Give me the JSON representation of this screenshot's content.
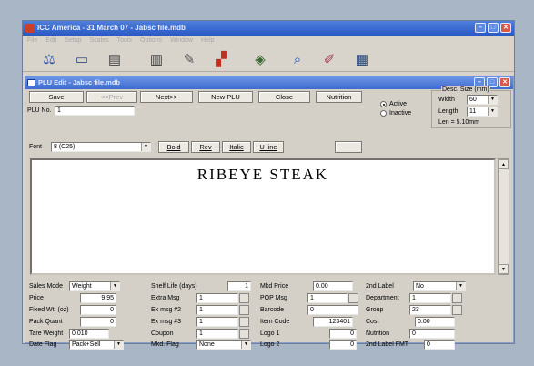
{
  "window": {
    "title": "ICC America - 31 March 07 - Jabsc file.mdb"
  },
  "menu": [
    "File",
    "Edit",
    "Setup",
    "Scales",
    "Tools",
    "Options",
    "Window",
    "Help"
  ],
  "toolbar": [
    {
      "name": "scale-icon",
      "glyph": "⚖"
    },
    {
      "name": "monitor-icon",
      "glyph": "▭"
    },
    {
      "name": "database-icon",
      "glyph": "▤"
    },
    {
      "name": "barcode-icon",
      "glyph": "▥"
    },
    {
      "name": "text-edit-icon",
      "glyph": "✎"
    },
    {
      "name": "chart-icon",
      "glyph": "▞"
    },
    {
      "name": "graphic-icon",
      "glyph": "◈"
    },
    {
      "name": "search-icon",
      "glyph": "⌕"
    },
    {
      "name": "pencil-icon",
      "glyph": "✐"
    },
    {
      "name": "screen-icon",
      "glyph": "▦"
    }
  ],
  "sub": {
    "title": "PLU Edit - Jabsc file.mdb"
  },
  "buttons": {
    "save": "Save",
    "prev": "<<Prev",
    "next": "Next>>",
    "newplu": "New PLU",
    "close": "Close",
    "nutrition": "Nutrition"
  },
  "plu": {
    "label": "PLU No.",
    "value": "1"
  },
  "status": {
    "active": "Active",
    "inactive": "Inactive"
  },
  "desc": {
    "title": "Desc. Size (mm)",
    "width_label": "Width",
    "width_value": "60",
    "length_label": "Length",
    "length_value": "11",
    "len_text": "Len = 5.10mm"
  },
  "font": {
    "label": "Font",
    "value": "8 (C25)"
  },
  "format": {
    "bold": "Bold",
    "rev": "Rev",
    "italic": "Italic",
    "uline": "U line"
  },
  "editor": {
    "text": "RIBEYE STEAK"
  },
  "fields": {
    "sales_mode": {
      "label": "Sales Mode",
      "value": "Weight"
    },
    "price": {
      "label": "Price",
      "value": "9.95"
    },
    "fixed_wt": {
      "label": "Fixed Wt. (oz)",
      "value": "0"
    },
    "pack_quant": {
      "label": "Pack Quant",
      "value": "0"
    },
    "tare_weight": {
      "label": "Tare Weight",
      "value": "0.010"
    },
    "date_flag": {
      "label": "Date Flag",
      "value": "Pack+Sell"
    },
    "shelf_life": {
      "label": "Shelf Life (days)",
      "value": "1"
    },
    "extra_msg": {
      "label": "Extra Msg",
      "value": "1"
    },
    "ex_msg2": {
      "label": "Ex msg #2",
      "value": "1"
    },
    "ex_msg3": {
      "label": "Ex msg #3",
      "value": "1"
    },
    "coupon": {
      "label": "Coupon",
      "value": "1"
    },
    "mkd_flag": {
      "label": "Mkd. Flag",
      "value": "None"
    },
    "mkd_price": {
      "label": "Mkd Price",
      "value": "0.00"
    },
    "pop_msg": {
      "label": "POP Msg",
      "value": "1"
    },
    "barcode": {
      "label": "Barcode",
      "value": "0"
    },
    "item_code": {
      "label": "Item Code",
      "value": "123401"
    },
    "logo1": {
      "label": "Logo 1",
      "value": "0"
    },
    "logo2": {
      "label": "Logo 2",
      "value": "0"
    },
    "second_label": {
      "label": "2nd Label",
      "value": "No"
    },
    "department": {
      "label": "Department",
      "value": "1"
    },
    "group": {
      "label": "Group",
      "value": "23"
    },
    "cost": {
      "label": "Cost",
      "value": "0.00"
    },
    "nutrition": {
      "label": "Nutrition",
      "value": "0"
    },
    "second_label_fmt": {
      "label": "2nd Label FMT",
      "value": "0"
    }
  }
}
